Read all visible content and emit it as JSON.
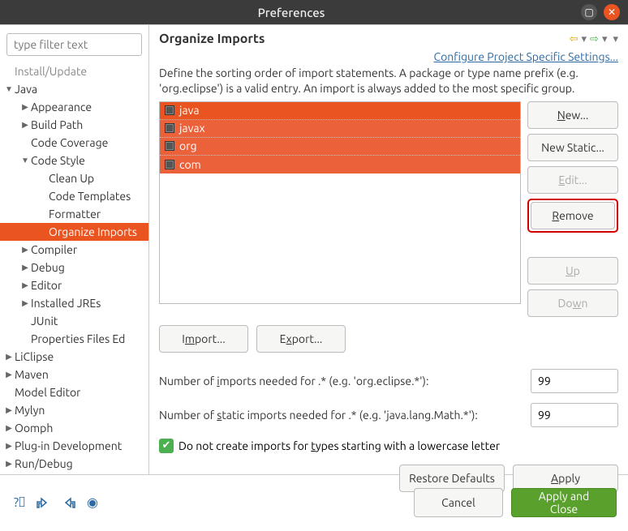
{
  "window": {
    "title": "Preferences"
  },
  "filter": {
    "placeholder": "type filter text"
  },
  "tree": [
    {
      "label": "Install/Update",
      "depth": 1,
      "twisty": "",
      "dim": true
    },
    {
      "label": "Java",
      "depth": 1,
      "twisty": "▼"
    },
    {
      "label": "Appearance",
      "depth": 2,
      "twisty": "▶"
    },
    {
      "label": "Build Path",
      "depth": 2,
      "twisty": "▶"
    },
    {
      "label": "Code Coverage",
      "depth": 2,
      "twisty": ""
    },
    {
      "label": "Code Style",
      "depth": 2,
      "twisty": "▼"
    },
    {
      "label": "Clean Up",
      "depth": 3,
      "twisty": ""
    },
    {
      "label": "Code Templates",
      "depth": 3,
      "twisty": ""
    },
    {
      "label": "Formatter",
      "depth": 3,
      "twisty": ""
    },
    {
      "label": "Organize Imports",
      "depth": 3,
      "twisty": "",
      "selected": true
    },
    {
      "label": "Compiler",
      "depth": 2,
      "twisty": "▶"
    },
    {
      "label": "Debug",
      "depth": 2,
      "twisty": "▶"
    },
    {
      "label": "Editor",
      "depth": 2,
      "twisty": "▶"
    },
    {
      "label": "Installed JREs",
      "depth": 2,
      "twisty": "▶"
    },
    {
      "label": "JUnit",
      "depth": 2,
      "twisty": ""
    },
    {
      "label": "Properties Files Ed",
      "depth": 2,
      "twisty": ""
    },
    {
      "label": "LiClipse",
      "depth": 1,
      "twisty": "▶"
    },
    {
      "label": "Maven",
      "depth": 1,
      "twisty": "▶"
    },
    {
      "label": "Model Editor",
      "depth": 1,
      "twisty": ""
    },
    {
      "label": "Mylyn",
      "depth": 1,
      "twisty": "▶"
    },
    {
      "label": "Oomph",
      "depth": 1,
      "twisty": "▶"
    },
    {
      "label": "Plug-in Development",
      "depth": 1,
      "twisty": "▶"
    },
    {
      "label": "Run/Debug",
      "depth": 1,
      "twisty": "▶"
    }
  ],
  "page": {
    "title": "Organize Imports",
    "configure_link": "Configure Project Specific Settings...",
    "description": "Define the sorting order of import statements. A package or type name prefix (e.g. 'org.eclipse') is a valid entry. An import is always added to the most specific group.",
    "entries": [
      "java",
      "javax",
      "org",
      "com"
    ],
    "buttons": {
      "new": "New...",
      "new_static": "New Static...",
      "edit": "Edit...",
      "remove": "Remove",
      "up": "Up",
      "down": "Down",
      "import": "Import...",
      "export": "Export..."
    },
    "num_imports_label": "Number of imports needed for .* (e.g. 'org.eclipse.*'):",
    "num_imports_value": "99",
    "num_static_label": "Number of static imports needed for .* (e.g. 'java.lang.Math.*'):",
    "num_static_value": "99",
    "checkbox_label": "Do not create imports for types starting with a lowercase letter",
    "checkbox_checked": true,
    "restore_defaults": "Restore Defaults",
    "apply": "Apply"
  },
  "footer": {
    "cancel": "Cancel",
    "apply_close": "Apply and Close"
  }
}
